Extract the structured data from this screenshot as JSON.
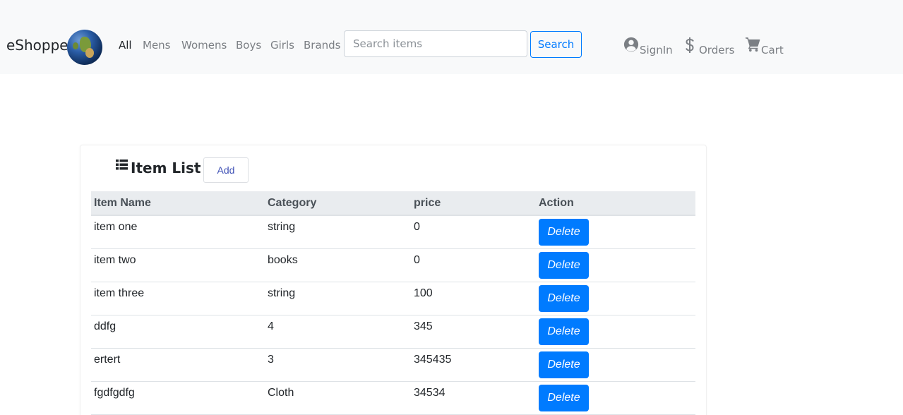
{
  "brand": {
    "name": "eShopper",
    "logo_icon": "globe-logo"
  },
  "nav": {
    "links": [
      {
        "label": "All",
        "active": true
      },
      {
        "label": "Mens",
        "active": false
      },
      {
        "label": "Womens",
        "active": false
      },
      {
        "label": "Boys",
        "active": false
      },
      {
        "label": "Girls",
        "active": false
      },
      {
        "label": "Brands",
        "active": false
      }
    ]
  },
  "search": {
    "placeholder": "Search items",
    "value": "",
    "button_label": "Search"
  },
  "account": {
    "signin": {
      "label": "SignIn",
      "icon": "user-circle-icon"
    },
    "orders": {
      "label": "Orders",
      "icon": "dollar-icon"
    },
    "cart": {
      "label": "Cart",
      "icon": "cart-icon"
    }
  },
  "item_list": {
    "title": "Item List",
    "title_icon": "list-icon",
    "add_label": "Add",
    "columns": [
      "Item Name",
      "Category",
      "price",
      "Action"
    ],
    "rows": [
      {
        "name": "item one",
        "category": "string",
        "price": "0",
        "action": "Delete"
      },
      {
        "name": "item two",
        "category": "books",
        "price": "0",
        "action": "Delete"
      },
      {
        "name": "item three",
        "category": "string",
        "price": "100",
        "action": "Delete"
      },
      {
        "name": "ddfg",
        "category": "4",
        "price": "345",
        "action": "Delete"
      },
      {
        "name": "ertert",
        "category": "3",
        "price": "345435",
        "action": "Delete"
      },
      {
        "name": "fgdfgdfg",
        "category": "Cloth",
        "price": "34534",
        "action": "Delete"
      }
    ]
  },
  "colors": {
    "primary": "#007bff",
    "navbar_bg": "#f8f9fa",
    "table_header_bg": "#e9ecef"
  }
}
